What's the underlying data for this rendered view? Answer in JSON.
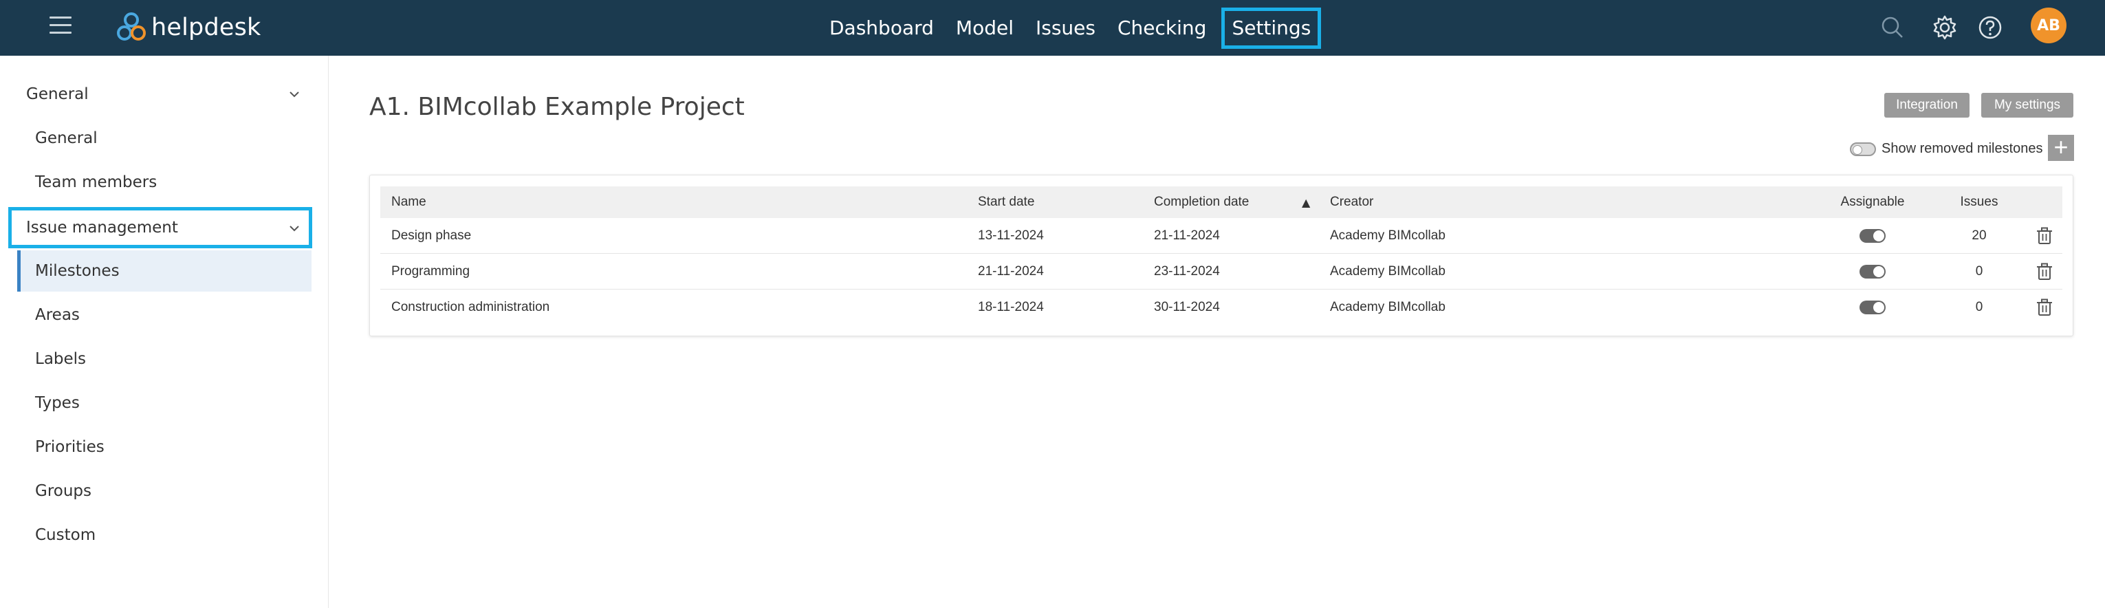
{
  "header": {
    "brand": "helpdesk",
    "nav": [
      "Dashboard",
      "Model",
      "Issues",
      "Checking",
      "Settings"
    ],
    "active_nav": "Settings",
    "avatar_initials": "AB",
    "icons": [
      "search-icon",
      "gear-icon",
      "help-icon"
    ]
  },
  "sidebar": {
    "group1": {
      "label": "General",
      "items": [
        "General",
        "Team members"
      ]
    },
    "group2": {
      "label": "Issue management",
      "items": [
        "Milestones",
        "Areas",
        "Labels",
        "Types",
        "Priorities",
        "Groups",
        "Custom"
      ]
    },
    "active_item": "Milestones"
  },
  "main": {
    "title": "A1. BIMcollab Example Project",
    "integration_label": "Integration",
    "my_settings_label": "My settings",
    "show_removed_label": "Show removed milestones",
    "add_symbol": "+"
  },
  "table": {
    "columns": {
      "name": "Name",
      "start": "Start date",
      "completion": "Completion date",
      "creator": "Creator",
      "assignable": "Assignable",
      "issues": "Issues"
    },
    "sort_indicator": "▲",
    "rows": [
      {
        "name": "Design phase",
        "start": "13-11-2024",
        "completion": "21-11-2024",
        "creator": "Academy BIMcollab",
        "assignable": true,
        "issues": "20"
      },
      {
        "name": "Programming",
        "start": "21-11-2024",
        "completion": "23-11-2024",
        "creator": "Academy BIMcollab",
        "assignable": true,
        "issues": "0"
      },
      {
        "name": "Construction administration",
        "start": "18-11-2024",
        "completion": "30-11-2024",
        "creator": "Academy BIMcollab",
        "assignable": true,
        "issues": "0"
      }
    ]
  },
  "colors": {
    "topbar": "#1b3a4f",
    "highlight": "#1ab0e8",
    "avatar": "#f0932b",
    "active_item_bg": "#e8f0f8"
  }
}
